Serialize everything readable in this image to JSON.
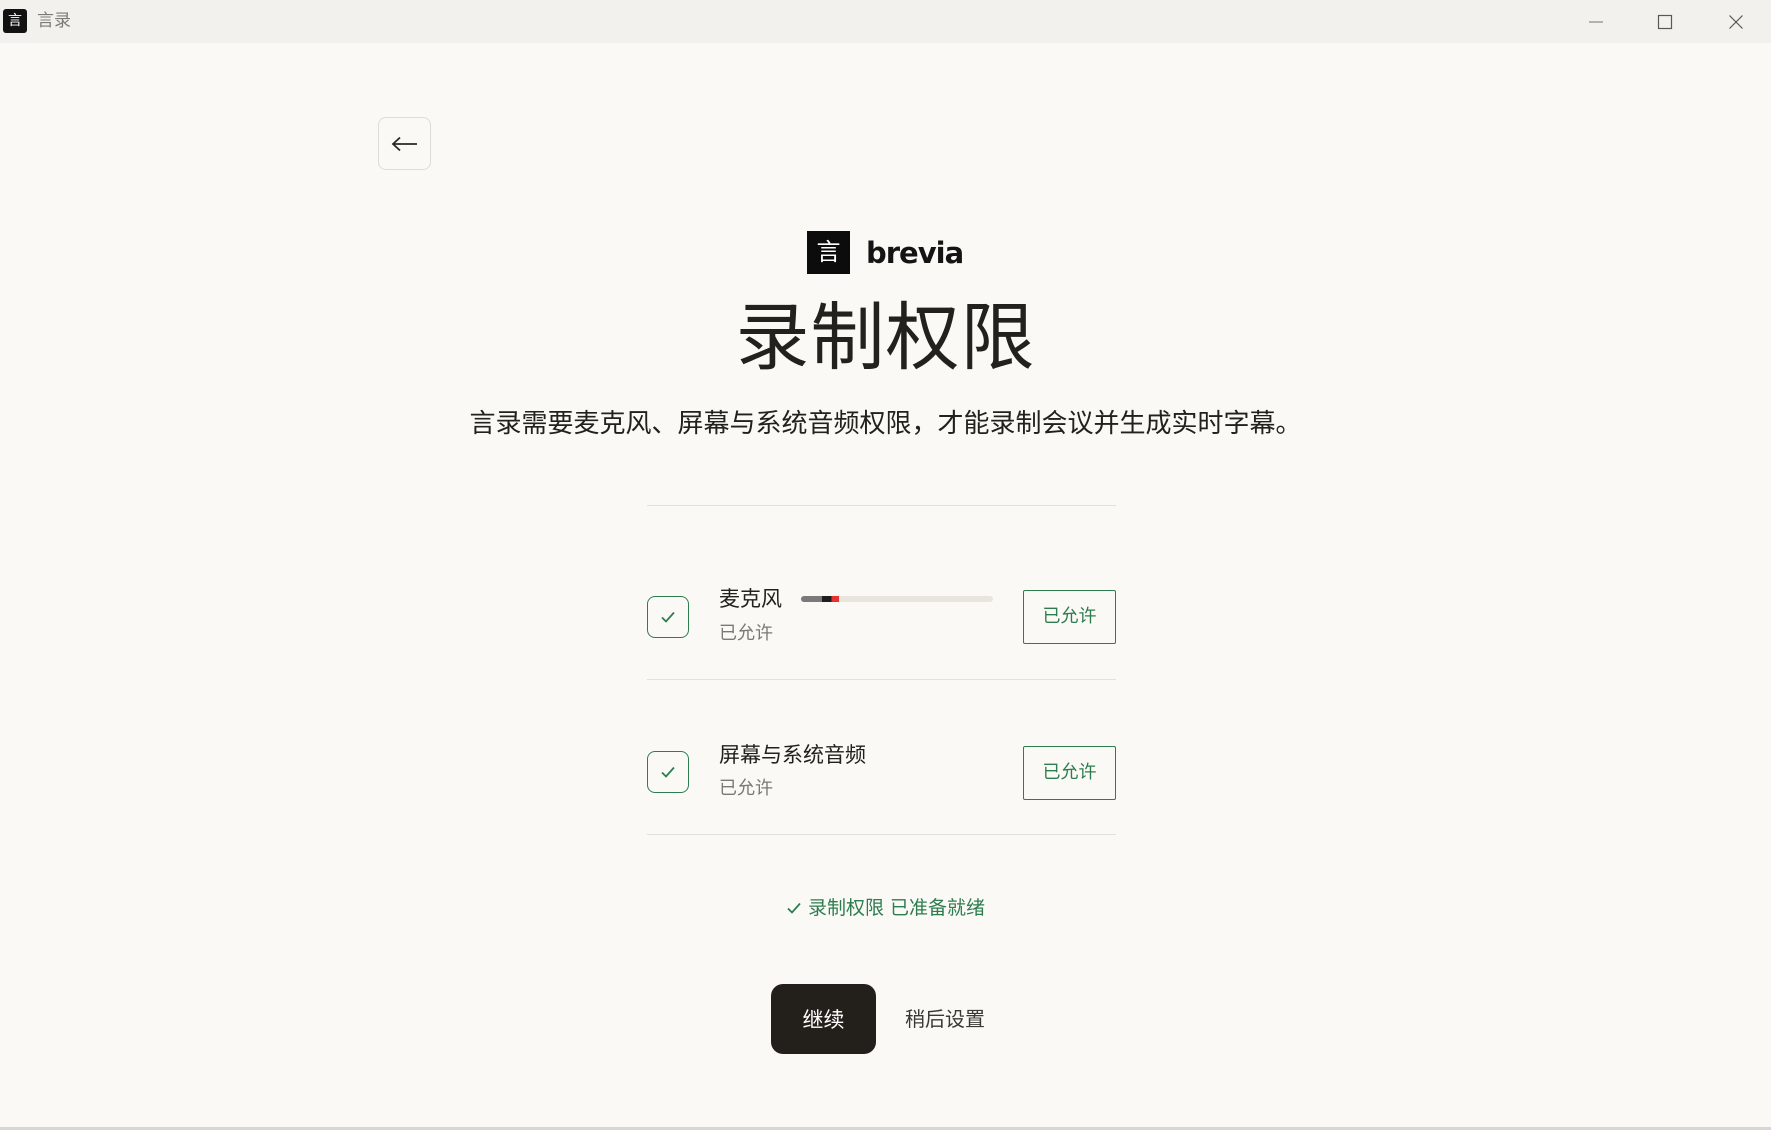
{
  "window": {
    "app_icon_glyph": "言",
    "title": "言录",
    "controls": [
      "minimize-icon",
      "maximize-icon",
      "close-icon"
    ]
  },
  "nav": {
    "back_icon": "arrow-left-icon"
  },
  "brand": {
    "logo_glyph": "言",
    "name": "brevia"
  },
  "header": {
    "title": "录制权限",
    "description": "言录需要麦克风、屏幕与系统音频权限，才能录制会议并生成实时字幕。"
  },
  "permissions": [
    {
      "name": "麦克风",
      "status": "已允许",
      "button_label": "已允许",
      "level": 0.2
    },
    {
      "name": "屏幕与系统音频",
      "status": "已允许",
      "button_label": "已允许"
    }
  ],
  "ready_message": "录制权限 已准备就绪",
  "actions": {
    "continue_label": "继续",
    "later_label": "稍后设置"
  },
  "colors": {
    "background": "#faf9f5",
    "accent_green": "#2e7d4f",
    "primary_button": "#23201b",
    "text": "#23211e",
    "muted_text": "#7b7974"
  }
}
